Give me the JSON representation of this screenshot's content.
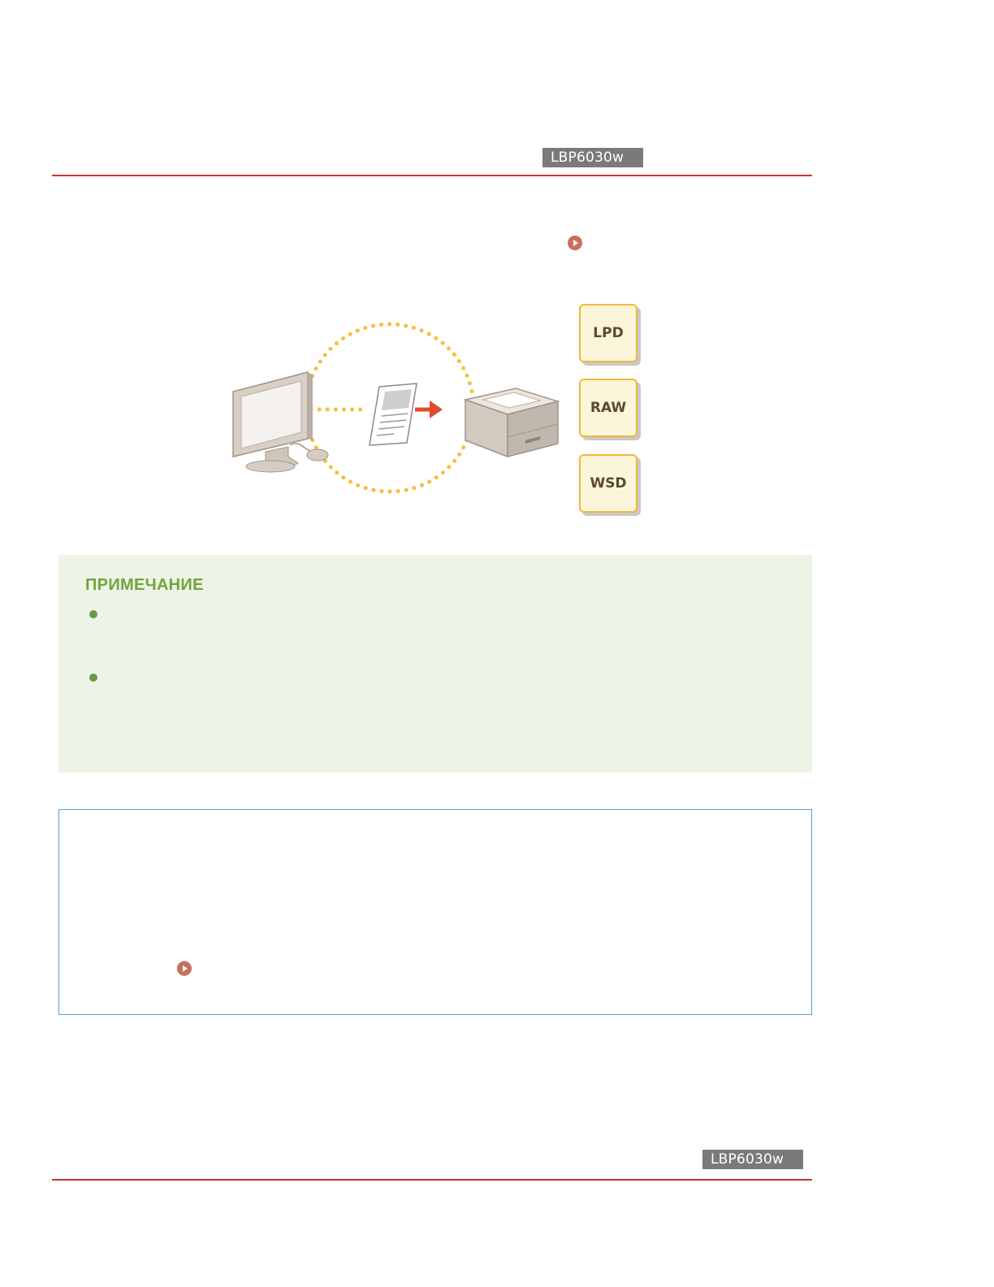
{
  "page": {
    "model_badge_top": "LBP6030w",
    "model_badge_bottom": "LBP6030w"
  },
  "diagram": {
    "protocols": [
      "LPD",
      "RAW",
      "WSD"
    ],
    "colors": {
      "dotted_circle": "#f5c040",
      "arrow": "#e04a2e",
      "protocol_border": "#f0b835",
      "protocol_fill": "#fbf5da"
    }
  },
  "note": {
    "title": "ПРИМЕЧАНИЕ",
    "bullet_color": "#6a9a3c"
  },
  "colors": {
    "rule": "#c8342a",
    "link_icon": "#c96f5a",
    "note_background": "#eef3e7",
    "info_border": "#5b9fd1"
  }
}
